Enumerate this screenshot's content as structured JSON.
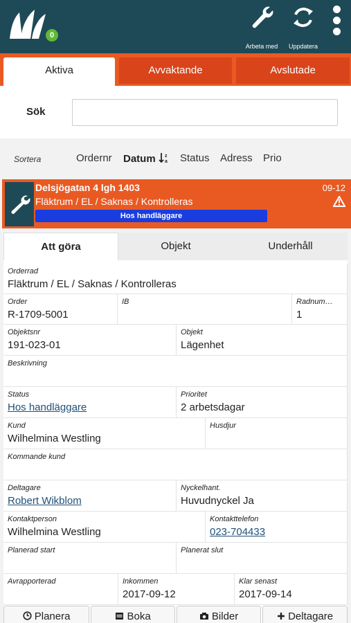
{
  "header": {
    "badge_count": "0",
    "work_with_label": "Arbeta med",
    "refresh_label": "Uppdatera",
    "icons": [
      "logo-icon",
      "wrench-icon",
      "refresh-icon",
      "menu-icon"
    ],
    "color": "#1e4a57"
  },
  "tabs": [
    {
      "label": "Aktiva",
      "active": true
    },
    {
      "label": "Avvaktande",
      "active": false
    },
    {
      "label": "Avslutade",
      "active": false
    }
  ],
  "search": {
    "label": "Sök",
    "value": "",
    "placeholder": ""
  },
  "sort": {
    "label": "Sortera",
    "options": [
      "Ordernr",
      "Datum",
      "Status",
      "Adress",
      "Prio"
    ],
    "active": "Datum"
  },
  "order": {
    "address": "Delsjögatan 4 lgh 1403",
    "date": "09-12",
    "description": "Fläktrum / EL / Saknas / Kontrolleras",
    "status": "Hos handläggare",
    "accent_color": "#e95a23",
    "status_color": "#1a3de0"
  },
  "detail_tabs": [
    {
      "label": "Att göra",
      "active": true
    },
    {
      "label": "Objekt",
      "active": false
    },
    {
      "label": "Underhåll",
      "active": false
    }
  ],
  "fields": {
    "orderrad": {
      "label": "Orderrad",
      "value": "Fläktrum / EL / Saknas / Kontrolleras"
    },
    "order": {
      "label": "Order",
      "value": "R-1709-5001"
    },
    "ib": {
      "label": "IB",
      "value": ""
    },
    "radnummer": {
      "label": "Radnum…",
      "value": "1"
    },
    "objektsnr": {
      "label": "Objektsnr",
      "value": "191-023-01"
    },
    "objekt": {
      "label": "Objekt",
      "value": "Lägenhet"
    },
    "beskrivning": {
      "label": "Beskrivning",
      "value": ""
    },
    "status": {
      "label": "Status",
      "value": "Hos handläggare"
    },
    "prioritet": {
      "label": "Prioritet",
      "value": "2 arbetsdagar"
    },
    "kund": {
      "label": "Kund",
      "value": "Wilhelmina Westling"
    },
    "husdjur": {
      "label": "Husdjur",
      "value": ""
    },
    "kommande_kund": {
      "label": "Kommande kund",
      "value": ""
    },
    "deltagare": {
      "label": "Deltagare",
      "value": "Robert Wikblom"
    },
    "nyckelhant": {
      "label": "Nyckelhant.",
      "value": "Huvudnyckel Ja"
    },
    "kontaktperson": {
      "label": "Kontaktperson",
      "value": "Wilhelmina Westling"
    },
    "kontakttelefon": {
      "label": "Kontakttelefon",
      "value": "023-704433"
    },
    "planerad_start": {
      "label": "Planerad start",
      "value": ""
    },
    "planerat_slut": {
      "label": "Planerat slut",
      "value": ""
    },
    "avrapporterad": {
      "label": "Avrapporterad",
      "value": ""
    },
    "inkommen": {
      "label": "Inkommen",
      "value": "2017-09-12"
    },
    "klar_senast": {
      "label": "Klar senast",
      "value": "2017-09-14"
    }
  },
  "actions": {
    "planera": "Planera",
    "boka": "Boka",
    "bilder": "Bilder",
    "deltagare": "Deltagare"
  }
}
